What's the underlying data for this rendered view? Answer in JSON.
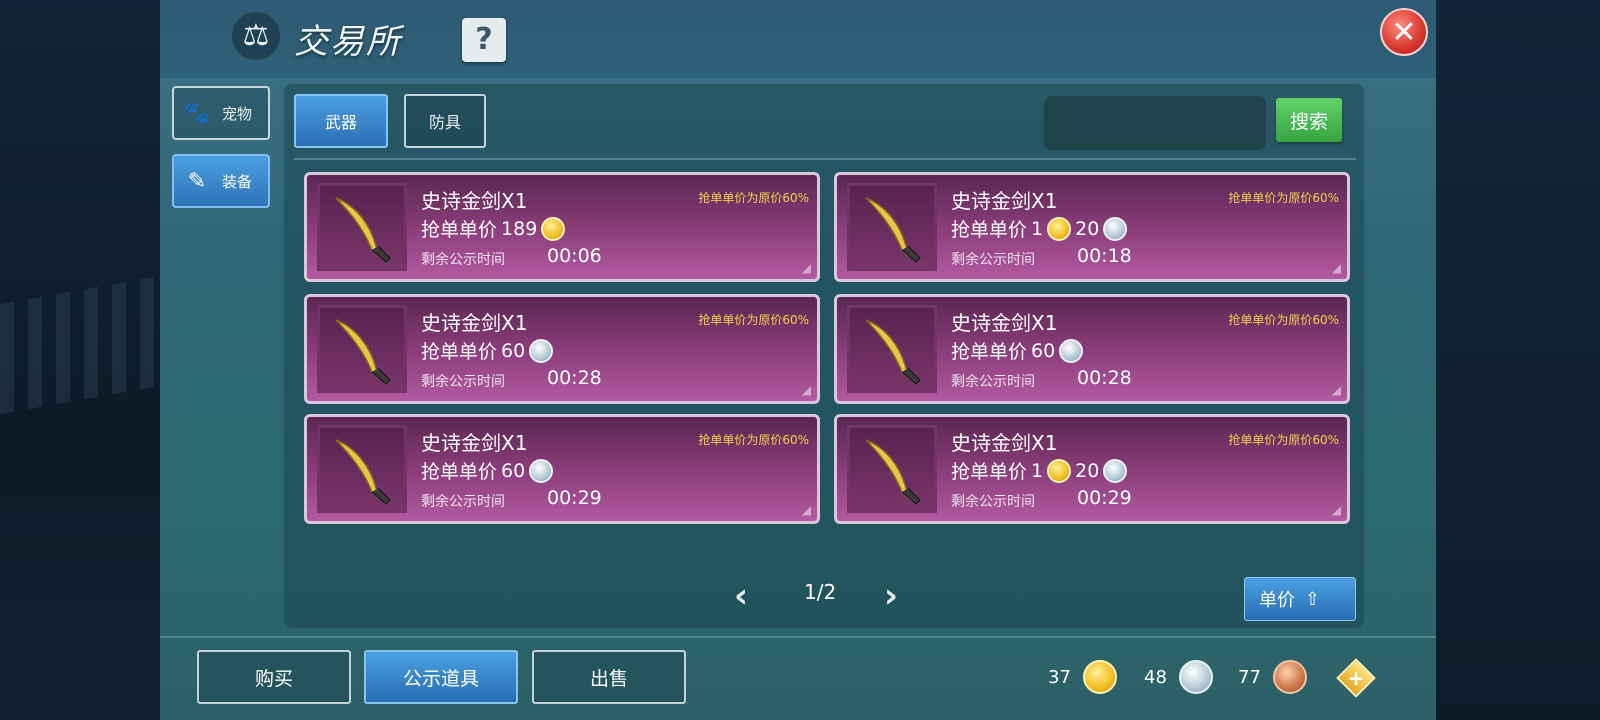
{
  "window": {
    "title": "交易所",
    "help_label": "?",
    "close_label": "✕"
  },
  "side_tabs": [
    {
      "label": "宠物",
      "icon": "paw-icon",
      "active": false
    },
    {
      "label": "装备",
      "icon": "equipment-icon",
      "active": true
    }
  ],
  "category_tabs": [
    {
      "label": "武器",
      "active": true
    },
    {
      "label": "防具",
      "active": false
    }
  ],
  "search": {
    "placeholder": "",
    "value": "",
    "button_label": "搜索"
  },
  "listings": [
    {
      "name": "史诗金剑X1",
      "note": "抢单单价为原价60%",
      "price_label": "抢单单价",
      "price": [
        {
          "amount": "189",
          "currency": "gold"
        }
      ],
      "time_label": "剩余公示时间",
      "time": "00:06"
    },
    {
      "name": "史诗金剑X1",
      "note": "抢单单价为原价60%",
      "price_label": "抢单单价",
      "price": [
        {
          "amount": "1",
          "currency": "gold"
        },
        {
          "amount": "20",
          "currency": "silver"
        }
      ],
      "time_label": "剩余公示时间",
      "time": "00:18"
    },
    {
      "name": "史诗金剑X1",
      "note": "抢单单价为原价60%",
      "price_label": "抢单单价",
      "price": [
        {
          "amount": "60",
          "currency": "silver"
        }
      ],
      "time_label": "剩余公示时间",
      "time": "00:28"
    },
    {
      "name": "史诗金剑X1",
      "note": "抢单单价为原价60%",
      "price_label": "抢单单价",
      "price": [
        {
          "amount": "60",
          "currency": "silver"
        }
      ],
      "time_label": "剩余公示时间",
      "time": "00:28"
    },
    {
      "name": "史诗金剑X1",
      "note": "抢单单价为原价60%",
      "price_label": "抢单单价",
      "price": [
        {
          "amount": "60",
          "currency": "silver"
        }
      ],
      "time_label": "剩余公示时间",
      "time": "00:29"
    },
    {
      "name": "史诗金剑X1",
      "note": "抢单单价为原价60%",
      "price_label": "抢单单价",
      "price": [
        {
          "amount": "1",
          "currency": "gold"
        },
        {
          "amount": "20",
          "currency": "silver"
        }
      ],
      "time_label": "剩余公示时间",
      "time": "00:29"
    }
  ],
  "pagination": {
    "prev": "‹",
    "text": "1/2",
    "next": "›"
  },
  "sort_button": {
    "label": "单价"
  },
  "bottom_tabs": [
    {
      "label": "购买",
      "active": false
    },
    {
      "label": "公示道具",
      "active": true
    },
    {
      "label": "出售",
      "active": false
    }
  ],
  "currencies": [
    {
      "amount": "37",
      "type": "gold"
    },
    {
      "amount": "48",
      "type": "silver"
    },
    {
      "amount": "77",
      "type": "copper"
    }
  ],
  "colors": {
    "card_purple": "#8e3f7d",
    "accent_blue": "#2f74b8",
    "search_green": "#36a442",
    "note_yellow": "#f5d04a",
    "close_red": "#d7372d"
  }
}
